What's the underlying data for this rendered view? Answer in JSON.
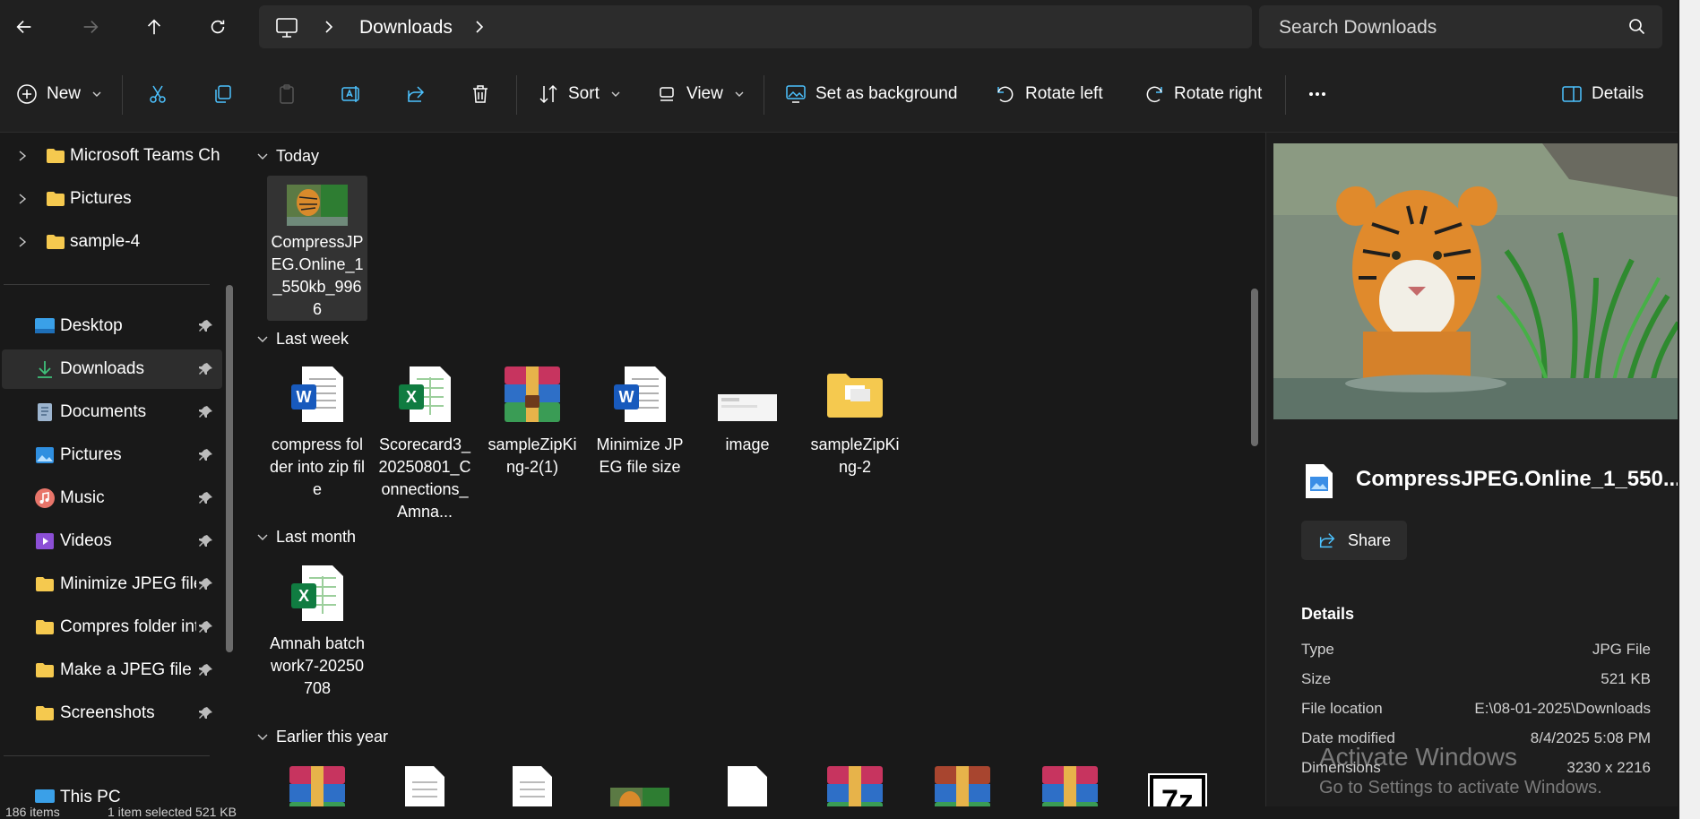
{
  "address": {
    "location": "Downloads",
    "search_placeholder": "Search Downloads"
  },
  "toolbar": {
    "new_label": "New",
    "sort_label": "Sort",
    "view_label": "View",
    "set_background_label": "Set as background",
    "rotate_left_label": "Rotate left",
    "rotate_right_label": "Rotate right",
    "details_label": "Details"
  },
  "nav": {
    "tree": [
      {
        "label": "Microsoft Teams Cha"
      },
      {
        "label": "Pictures"
      },
      {
        "label": "sample-4"
      }
    ],
    "quick_access": [
      {
        "label": "Desktop",
        "icon": "desktop-icon"
      },
      {
        "label": "Downloads",
        "icon": "download-icon"
      },
      {
        "label": "Documents",
        "icon": "documents-icon"
      },
      {
        "label": "Pictures",
        "icon": "pictures-icon"
      },
      {
        "label": "Music",
        "icon": "music-icon"
      },
      {
        "label": "Videos",
        "icon": "videos-icon"
      },
      {
        "label": "Minimize JPEG file s",
        "icon": "folder-icon"
      },
      {
        "label": "Compres folder into",
        "icon": "folder-icon"
      },
      {
        "label": "Make a JPEG file sm",
        "icon": "folder-icon"
      },
      {
        "label": "Screenshots",
        "icon": "folder-icon"
      }
    ],
    "this_pc": "This PC"
  },
  "groups": {
    "today": "Today",
    "last_week": "Last week",
    "last_month": "Last month",
    "earlier": "Earlier this year"
  },
  "files": {
    "today": [
      {
        "name": "CompressJPEG.Online_1_550kb_9966",
        "icon": "tiger-thumbnail"
      }
    ],
    "last_week": [
      {
        "name": "compress folder into zip file",
        "icon": "word-icon"
      },
      {
        "name": "Scorecard3_20250801_Connections_Amna...",
        "icon": "excel-icon"
      },
      {
        "name": "sampleZipKing-2(1)",
        "icon": "winrar-icon"
      },
      {
        "name": "Minimize JPEG file size",
        "icon": "word-icon"
      },
      {
        "name": "image",
        "icon": "image-thumbnail"
      },
      {
        "name": "sampleZipKing-2",
        "icon": "zip-folder-icon"
      }
    ],
    "last_month": [
      {
        "name": "Amnah batch work7-20250708",
        "icon": "excel-icon"
      }
    ],
    "earlier": [
      {
        "icon": "winrar-icon"
      },
      {
        "icon": "document-icon"
      },
      {
        "icon": "document-icon"
      },
      {
        "icon": "tiger-thumbnail"
      },
      {
        "icon": "blank-file-icon"
      },
      {
        "icon": "winrar-icon"
      },
      {
        "icon": "winrar-icon"
      },
      {
        "icon": "winrar-icon"
      },
      {
        "icon": "7zip-icon"
      }
    ]
  },
  "details": {
    "file_name": "CompressJPEG.Online_1_550...",
    "share_label": "Share",
    "section_title": "Details",
    "rows": [
      {
        "key": "Type",
        "value": "JPG File"
      },
      {
        "key": "Size",
        "value": "521 KB"
      },
      {
        "key": "File location",
        "value": "E:\\08-01-2025\\Downloads"
      },
      {
        "key": "Date modified",
        "value": "8/4/2025 5:08 PM"
      },
      {
        "key": "Dimensions",
        "value": "3230 x 2216"
      }
    ]
  },
  "status": {
    "count": "186 items",
    "selected": "1 item selected 521 KB"
  },
  "watermark": {
    "line1": "Activate Windows",
    "line2": "Go to Settings to activate Windows."
  },
  "colors": {
    "background": "#191919",
    "toolbar": "#202020",
    "selected": "#2d2d2d",
    "accent": "#4cc2ff",
    "folder": "#f5c94f"
  }
}
